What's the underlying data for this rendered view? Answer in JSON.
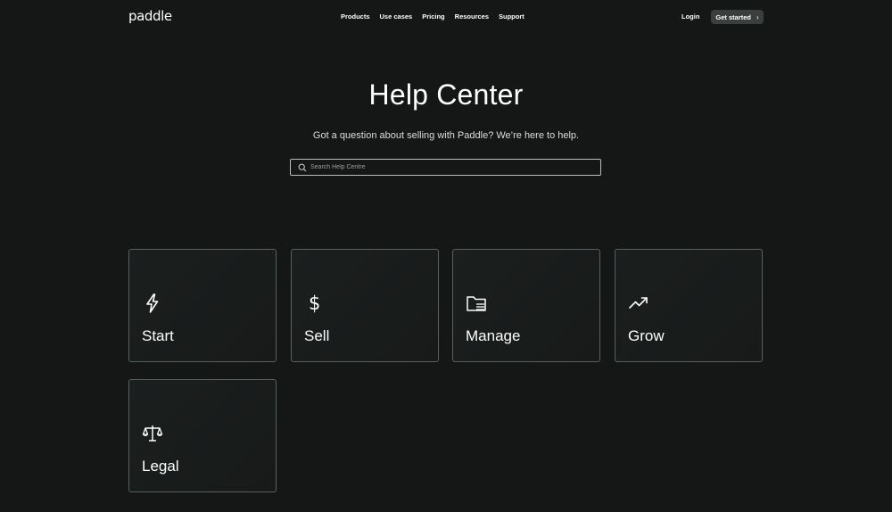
{
  "header": {
    "logo": "paddle",
    "nav": [
      "Products",
      "Use cases",
      "Pricing",
      "Resources",
      "Support"
    ],
    "login": "Login",
    "cta": "Get started",
    "cta_icon": "chevron-right-icon"
  },
  "hero": {
    "title": "Help Center",
    "subtitle": "Got a question about selling with Paddle? We’re here to help.",
    "search_placeholder": "Search Help Centre",
    "search_icon": "search-icon"
  },
  "categories": [
    {
      "label": "Start",
      "icon": "lightning-icon"
    },
    {
      "label": "Sell",
      "icon": "dollar-icon"
    },
    {
      "label": "Manage",
      "icon": "folder-icon"
    },
    {
      "label": "Grow",
      "icon": "trending-up-icon"
    },
    {
      "label": "Legal",
      "icon": "scales-icon"
    }
  ],
  "colors": {
    "background": "#141716",
    "card_border": "#5a605d",
    "button_bg": "#3a3f3d",
    "text": "#ffffff"
  }
}
